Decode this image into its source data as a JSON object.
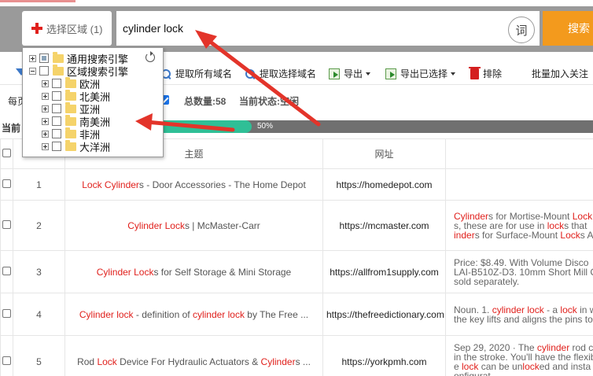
{
  "search": {
    "region_label": "选择区域 (1)",
    "query": "cylinder lock",
    "ci_label": "词",
    "button_label": "搜索"
  },
  "toolbar": {
    "extract_all_label": "提取所有域名",
    "extract_selected_label": "提取选择域名",
    "export_label": "导出",
    "export_selected_label": "导出已选择",
    "exclude_label": "排除",
    "batch_follow_label": "批量加入关注"
  },
  "status": {
    "per_page_prefix": "每页",
    "total_label": "总数量:",
    "total_value": "58",
    "state_label": "当前状态:",
    "state_value": "空闲"
  },
  "progress": {
    "prefix": "当前",
    "percent": 50,
    "label": "50%"
  },
  "tree": {
    "general": "通用搜索引擎",
    "region": "区域搜索引擎",
    "regions": [
      "欧洲",
      "北美洲",
      "亚洲",
      "南美洲",
      "非洲",
      "大洋洲"
    ]
  },
  "table": {
    "headers": {
      "title": "主题",
      "url": "网址"
    },
    "rows": [
      {
        "num": "1",
        "title": [
          {
            "t": "Lock Cylinder",
            "h": true
          },
          {
            "t": "s - Door Accessories - The Home Depot",
            "h": false
          }
        ],
        "url": "https://homedepot.com",
        "desc": [
          []
        ]
      },
      {
        "num": "2",
        "title": [
          {
            "t": "Cylinder Lock",
            "h": true
          },
          {
            "t": "s | McMaster-Carr",
            "h": false
          }
        ],
        "url": "https://mcmaster.com",
        "desc": [
          [
            {
              "t": "Cylinder",
              "h": true
            },
            {
              "t": "s for Mortise-Mount ",
              "h": false
            },
            {
              "t": "Lock",
              "h": true
            }
          ],
          [
            {
              "t": "s, these are for use in ",
              "h": false
            },
            {
              "t": "lock",
              "h": true
            },
            {
              "t": "s that",
              "h": false
            }
          ],
          [
            {
              "t": "inder",
              "h": true
            },
            {
              "t": "s for Surface-Mount ",
              "h": false
            },
            {
              "t": "Lock",
              "h": true
            },
            {
              "t": "s A",
              "h": false
            }
          ]
        ]
      },
      {
        "num": "3",
        "title": [
          {
            "t": "Cylinder Lock",
            "h": true
          },
          {
            "t": "s for Self Storage & Mini Storage",
            "h": false
          }
        ],
        "url": "https://allfrom1supply.com",
        "desc": [
          [
            {
              "t": "Price: $8.49. With Volume Disco",
              "h": false
            }
          ],
          [
            {
              "t": "LAI-B510Z-D3. 10mm Short Mill C",
              "h": false
            }
          ],
          [
            {
              "t": "sold separately.",
              "h": false
            }
          ]
        ]
      },
      {
        "num": "4",
        "title": [
          {
            "t": "Cylinder lock",
            "h": true
          },
          {
            "t": " - definition of ",
            "h": false
          },
          {
            "t": "cylinder lock",
            "h": true
          },
          {
            "t": " by The Free ...",
            "h": false
          }
        ],
        "url": "https://thefreedictionary.com",
        "desc": [
          [
            {
              "t": "Noun. 1. ",
              "h": false
            },
            {
              "t": "cylinder lock",
              "h": true
            },
            {
              "t": " - a ",
              "h": false
            },
            {
              "t": "lock",
              "h": true
            },
            {
              "t": " in w",
              "h": false
            }
          ],
          [
            {
              "t": "the key lifts and aligns the pins to",
              "h": false
            }
          ]
        ]
      },
      {
        "num": "5",
        "title": [
          {
            "t": "Rod ",
            "h": false
          },
          {
            "t": "Lock",
            "h": true
          },
          {
            "t": " Device For Hydraulic Actuators & ",
            "h": false
          },
          {
            "t": "Cylinder",
            "h": true
          },
          {
            "t": "s ...",
            "h": false
          }
        ],
        "url": "https://yorkpmh.com",
        "desc": [
          [
            {
              "t": "Sep 29, 2020 · The ",
              "h": false
            },
            {
              "t": "cylinder",
              "h": true
            },
            {
              "t": " rod c",
              "h": false
            }
          ],
          [
            {
              "t": "in the stroke. You'll have the flexib",
              "h": false
            }
          ],
          [
            {
              "t": "e ",
              "h": false
            },
            {
              "t": "lock",
              "h": true
            },
            {
              "t": " can be un",
              "h": false
            },
            {
              "t": "lock",
              "h": true
            },
            {
              "t": "ed and insta",
              "h": false
            }
          ],
          [
            {
              "t": "onfigurat",
              "h": false
            }
          ]
        ]
      }
    ]
  },
  "colors": {
    "accent_orange": "#f39a1d",
    "highlight_red": "#e0201c",
    "progress_green": "#2fbf96",
    "arrow_red": "#e3342a"
  }
}
